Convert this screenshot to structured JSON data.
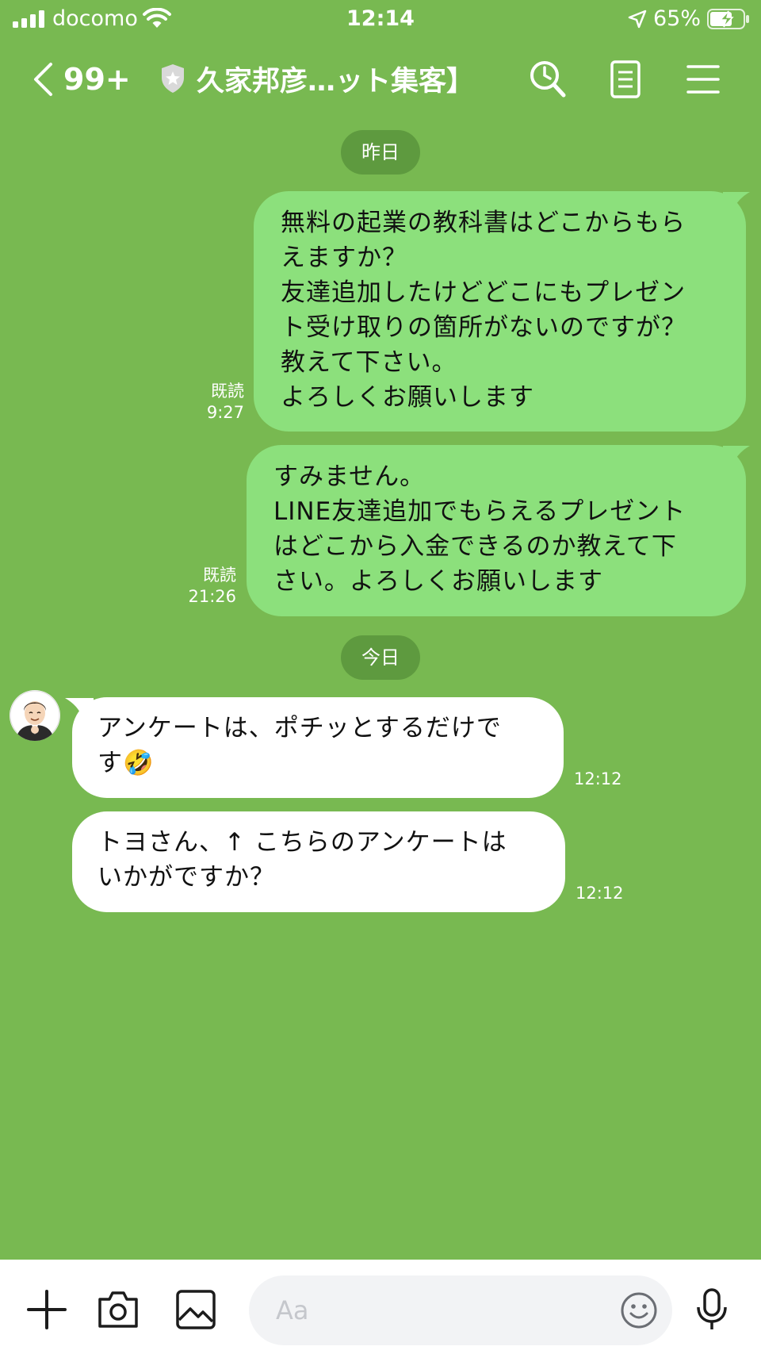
{
  "status_bar": {
    "carrier": "docomo",
    "time": "12:14",
    "battery_percent": "65%"
  },
  "header": {
    "unread_count": "99+",
    "chat_title": "久家邦彦…ット集客】"
  },
  "messages": {
    "date_yesterday": "昨日",
    "date_today": "今日",
    "out1": {
      "lines": [
        "無料の起業の教科書はどこからもら",
        "えますか？",
        "友達追加したけどどこにもプレゼン",
        "ト受け取りの箇所がないのですが？",
        "教えて下さい。",
        "よろしくお願いします"
      ],
      "read_label": "既読",
      "time": "9:27"
    },
    "out2": {
      "lines": [
        "すみません。",
        "LINE友達追加でもらえるプレゼント",
        "はどこから入金できるのか教えて下",
        "さい。よろしくお願いします"
      ],
      "read_label": "既読",
      "time": "21:26"
    },
    "in1": {
      "lines": [
        "アンケートは、ポチッとするだけで",
        "す🤣"
      ],
      "time": "12:12"
    },
    "in2": {
      "lines": [
        "トヨさん、↑ こちらのアンケートは",
        "いかがですか？"
      ],
      "time": "12:12"
    }
  },
  "input": {
    "placeholder": "Aa"
  },
  "icons": {
    "signal": "signal-icon",
    "wifi": "wifi-icon",
    "location": "location-arrow-icon",
    "battery": "battery-charging-icon",
    "back": "chevron-left-icon",
    "shield": "shield-icon",
    "search": "search-icon",
    "notes": "notes-icon",
    "menu": "hamburger-menu-icon",
    "plus": "plus-icon",
    "camera": "camera-icon",
    "photo": "photo-icon",
    "emoji": "emoji-icon",
    "mic": "microphone-icon"
  },
  "colors": {
    "background": "#78b951",
    "outgoing_bubble": "#8ce07c",
    "incoming_bubble": "#ffffff",
    "date_pill": "#5e9a3f"
  }
}
